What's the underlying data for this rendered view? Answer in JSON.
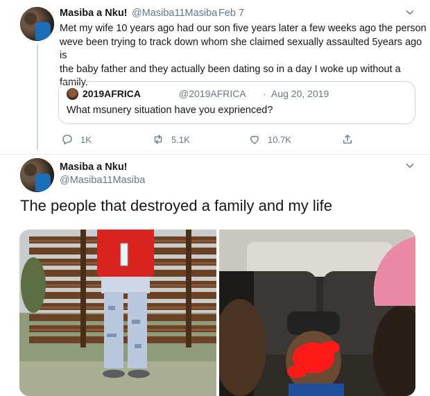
{
  "tweet1": {
    "display_name": "Masiba a Nku!",
    "handle": "@Masiba11Masiba",
    "dot": "·",
    "date": "Feb 7",
    "lines": [
      "Met my wife 10 years ago had our son five years later a few weeks ago the person",
      "weve been trying to track down whom she claimed sexually assaulted 5years ago is",
      "the baby father and they actually been dating so in a day I woke up without a",
      "family."
    ],
    "quote": {
      "display_name": "2019AFRICA",
      "handle": "@2019AFRICA",
      "dot": "·",
      "date": "Aug 20, 2019",
      "text": "What msunery situation have you exprienced?"
    },
    "actions": {
      "replies": "1K",
      "retweets": "5.1K",
      "likes": "10.7K"
    }
  },
  "tweet2": {
    "display_name": "Masiba a Nku!",
    "handle": "@Masiba11Masiba",
    "text": "The people that destroyed a family and my life"
  },
  "icons": {
    "reply": "reply-icon",
    "retweet": "retweet-icon",
    "like": "heart-icon",
    "share": "share-icon",
    "caret": "chevron-down-icon"
  },
  "colors": {
    "text": "#14171a",
    "muted": "#657786",
    "border": "#ccd6dd"
  }
}
